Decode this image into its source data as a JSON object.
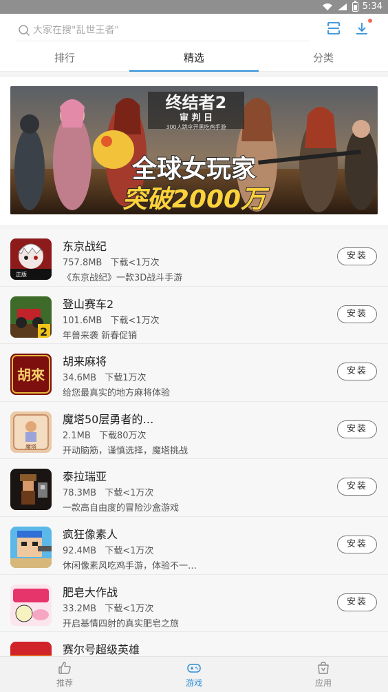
{
  "status": {
    "time": "5:34"
  },
  "search": {
    "placeholder": "大家在搜\"乱世王者\""
  },
  "tabs": [
    {
      "label": "排行"
    },
    {
      "label": "精选"
    },
    {
      "label": "分类"
    }
  ],
  "banner": {
    "line1": "终结者2",
    "line2": "审 判 日",
    "line3": "300人跳伞开黑吃鸡手游",
    "line4": "全球女玩家",
    "line5": "突破2000万"
  },
  "install_label": "安装",
  "games": [
    {
      "name": "东京战纪",
      "size": "757.8MB",
      "downloads": "下载<1万次",
      "desc": "《东京战纪》一款3D战斗手游"
    },
    {
      "name": "登山赛车2",
      "size": "101.6MB",
      "downloads": "下载<1万次",
      "desc": "年兽来袭 新春促销"
    },
    {
      "name": "胡来麻将",
      "size": "34.6MB",
      "downloads": "下载1万次",
      "desc": "给您最真实的地方麻将体验"
    },
    {
      "name": "魔塔50层勇者的…",
      "size": "2.1MB",
      "downloads": "下载80万次",
      "desc": "开动脑筋，谨慎选择，魔塔挑战"
    },
    {
      "name": "泰拉瑞亚",
      "size": "78.3MB",
      "downloads": "下载<1万次",
      "desc": "一款高自由度的冒险沙盒游戏"
    },
    {
      "name": "疯狂像素人",
      "size": "92.4MB",
      "downloads": "下载<1万次",
      "desc": "休闲像素风吃鸡手游，体验不一…"
    },
    {
      "name": "肥皂大作战",
      "size": "33.2MB",
      "downloads": "下载<1万次",
      "desc": "开启基情四射的真实肥皂之旅"
    },
    {
      "name": "赛尔号超级英雄",
      "size": "",
      "downloads": "",
      "desc": ""
    }
  ],
  "icon_text": {
    "game0": "正版",
    "game1": "2",
    "game2": "胡來",
    "game3": "魔塔"
  },
  "bottom_nav": [
    {
      "label": "推荐",
      "icon": "thumb-up-icon"
    },
    {
      "label": "游戏",
      "icon": "gamepad-icon"
    },
    {
      "label": "应用",
      "icon": "bag-icon"
    }
  ],
  "colors": {
    "accent": "#2e8fd8",
    "badge": "#f26a55"
  }
}
